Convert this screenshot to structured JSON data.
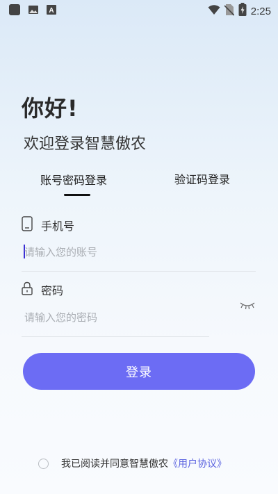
{
  "status_bar": {
    "time": "2:25",
    "left_icons": [
      "app-square-icon",
      "image-icon",
      "font-a-icon"
    ],
    "right_icons": [
      "wifi-icon",
      "no-sim-icon",
      "battery-charging-icon"
    ]
  },
  "greeting": "你好!",
  "subtitle": "欢迎登录智慧傲农",
  "tabs": [
    {
      "label": "账号密码登录",
      "active": true
    },
    {
      "label": "验证码登录",
      "active": false
    }
  ],
  "account": {
    "label": "手机号",
    "icon": "phone-icon",
    "placeholder": "请输入您的账号",
    "value": ""
  },
  "password": {
    "label": "密码",
    "icon": "lock-icon",
    "placeholder": "请输入您的密码",
    "value": "",
    "toggle_icon": "eye-closed-icon"
  },
  "login_button": "登录",
  "agreement": {
    "text": "我已阅读并同意智慧傲农",
    "link": "《用户协议》",
    "checked": false
  },
  "colors": {
    "accent": "#6c6cf4",
    "link": "#5b63e0",
    "caret": "#3a2fd4"
  }
}
